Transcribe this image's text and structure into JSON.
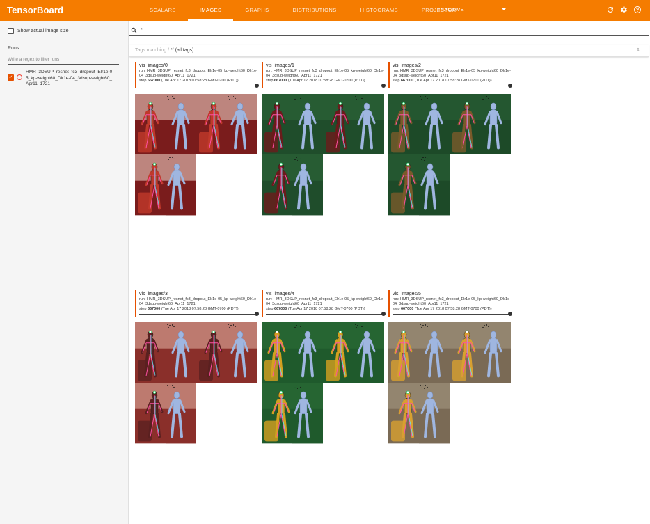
{
  "app": {
    "brand": "TensorBoard",
    "tabs": [
      "SCALARS",
      "IMAGES",
      "GRAPHS",
      "DISTRIBUTIONS",
      "HISTOGRAMS",
      "PROJECTOR"
    ],
    "active_tab": "IMAGES",
    "inactive_label": "INACTIVE",
    "icons": [
      "refresh-icon",
      "gear-icon",
      "help-icon"
    ]
  },
  "sidebar": {
    "show_actual_size": "Show actual image size",
    "runs_title": "Runs",
    "runs_filter_placeholder": "Write a regex to filter runs",
    "run_label": "HMR_3DSUP_resnet_fc3_dropout_Elr1e-05_kp-weight60_Dlr1e-04_3dsup-weight60_Apr11_1721"
  },
  "main": {
    "search_value": ".*",
    "tags_prefix": "Tags matching /",
    "tags_regex": ".*",
    "tags_suffix": "/",
    "tags_count": "(all tags)"
  },
  "cards": [
    {
      "title": "vis_images/0",
      "run": "run: HMR_3DSUP_resnet_fc3_dropout_Elr1e-05_kp-weight60_Dlr1e-04_3dsup-weight60_Apr11_1721",
      "step_prefix": "step",
      "step": "667000",
      "time": "(Tue Apr 17 2018 07:58:28 GMT-0700 (PDT))",
      "bg": "#7a1c1c",
      "bg2": "#f4ddd0",
      "accent": "#c0392b"
    },
    {
      "title": "vis_images/1",
      "run": "run: HMR_3DSUP_resnet_fc3_dropout_Elr1e-05_kp-weight60_Dlr1e-04_3dsup-weight60_Apr11_1721",
      "step_prefix": "step",
      "step": "667000",
      "time": "(Tue Apr 17 2018 07:58:28 GMT-0700 (PDT))",
      "bg": "#1f4d2b",
      "bg2": "#2d6a3a",
      "accent": "#6b1b1b"
    },
    {
      "title": "vis_images/2",
      "run": "run: HMR_3DSUP_resnet_fc3_dropout_Elr1e-05_kp-weight60_Dlr1e-04_3dsup-weight60_Apr11_1721",
      "step_prefix": "step",
      "step": "667000",
      "time": "(Tue Apr 17 2018 07:58:28 GMT-0700 (PDT))",
      "bg": "#1d4a28",
      "bg2": "#2a6236",
      "accent": "#7a5a2a"
    },
    {
      "title": "vis_images/3",
      "run": "run: HMR_3DSUP_resnet_fc3_dropout_Elr1e-05_kp-weight60_Dlr1e-04_3dsup-weight60_Apr11_1721",
      "step_prefix": "step",
      "step": "667000",
      "time": "(Tue Apr 17 2018 07:58:28 GMT-0700 (PDT))",
      "bg": "#8a2f2a",
      "bg2": "#e8b8a8",
      "accent": "#5a2020"
    },
    {
      "title": "vis_images/4",
      "run": "run: HMR_3DSUP_resnet_fc3_dropout_Elr1e-05_kp-weight60_Dlr1e-04_3dsup-weight60_Apr11_1721",
      "step_prefix": "step",
      "step": "667000",
      "time": "(Tue Apr 17 2018 07:58:28 GMT-0700 (PDT))",
      "bg": "#1f5a2c",
      "bg2": "#2b7038",
      "accent": "#d4a020"
    },
    {
      "title": "vis_images/5",
      "run": "run: HMR_3DSUP_resnet_fc3_dropout_Elr1e-05_kp-weight60_Dlr1e-04_3dsup-weight60_Apr11_1721",
      "step_prefix": "step",
      "step": "667000",
      "time": "(Tue Apr 17 2018 07:58:28 GMT-0700 (PDT))",
      "bg": "#7a6a55",
      "bg2": "#a89a85",
      "accent": "#d8a030"
    }
  ],
  "colors": {
    "header": "#f57c00",
    "run_accent": "#e65100",
    "mesh": "#9fb6e0"
  }
}
